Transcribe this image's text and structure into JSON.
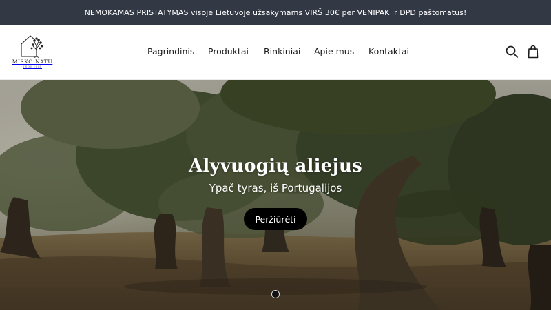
{
  "announcement": {
    "text": "NEMOKAMAS PRISTATYMAS visoje Lietuvoje užsakymams VIRŠ 30€ per VENIPAK ir DPD paštomatus!"
  },
  "header": {
    "logo": {
      "name": "MIŠKO NATŪ",
      "sub": "KROMELIS",
      "icon": "house-tree-logo"
    },
    "nav": [
      {
        "label": "Pagrindinis"
      },
      {
        "label": "Produktai"
      },
      {
        "label": "Rinkiniai"
      },
      {
        "label": "Apie mus"
      },
      {
        "label": "Kontaktai"
      }
    ],
    "icons": {
      "search": "search-icon",
      "cart": "shopping-bag-icon"
    }
  },
  "hero": {
    "title": "Alyvuogių aliejus",
    "subtitle": "Ypač tyras, iš Portugalijos",
    "button_label": "Peržiūrėti",
    "slides": {
      "current": 1,
      "total": 1
    }
  },
  "colors": {
    "announcement_bg": "#333845",
    "button_bg": "#000000",
    "text": "#1c1c1c"
  }
}
